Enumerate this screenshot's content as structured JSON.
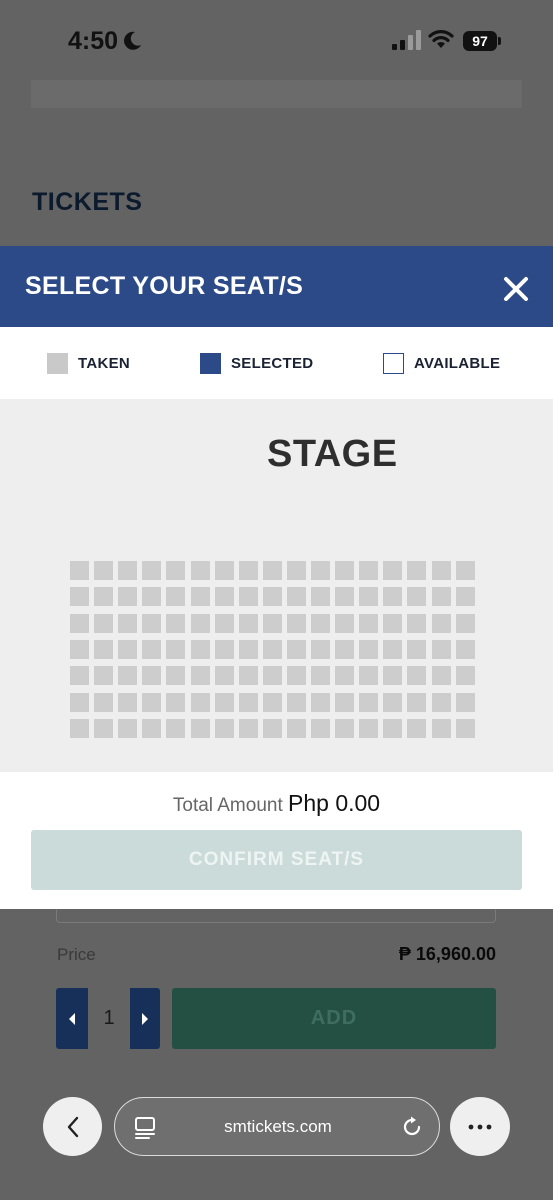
{
  "status_bar": {
    "time": "4:50",
    "battery": "97"
  },
  "page": {
    "heading": "TICKETS",
    "price_label": "Price",
    "price_value": "₱ 16,960.00",
    "quantity": "1",
    "add_label": "ADD"
  },
  "modal": {
    "title": "SELECT YOUR SEAT/S",
    "legend": {
      "taken": "TAKEN",
      "selected": "SELECTED",
      "available": "AVAILABLE"
    },
    "stage_label": "STAGE",
    "seats": {
      "rows": 7,
      "columns": 17,
      "state": "taken"
    },
    "total_label": "Total Amount",
    "total_value": "Php 0.00",
    "confirm_label": "CONFIRM SEAT/S",
    "colors": {
      "header": "#2b4a87",
      "seat_taken": "#cdcdcd",
      "confirm_disabled": "#cadbd9"
    }
  },
  "browser": {
    "url": "smtickets.com"
  }
}
